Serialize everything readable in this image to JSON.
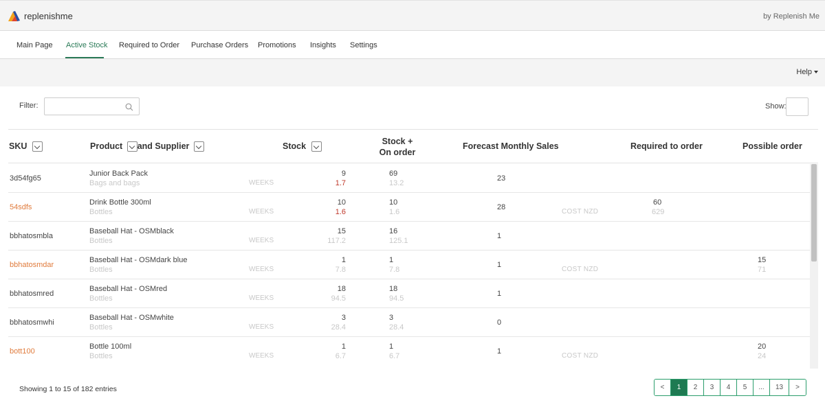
{
  "app": {
    "name": "replenishme",
    "byline": "by Replenish Me"
  },
  "nav": {
    "items": [
      {
        "label": "Main Page"
      },
      {
        "label": "Active Stock"
      },
      {
        "label": "Required to Order"
      },
      {
        "label": "Purchase Orders"
      },
      {
        "label": "Promotions"
      },
      {
        "label": "Insights"
      },
      {
        "label": "Settings"
      }
    ],
    "active": "Active Stock"
  },
  "help": {
    "label": "Help"
  },
  "filter": {
    "label": "Filter:",
    "value": ""
  },
  "show": {
    "label": "Show:",
    "value": ""
  },
  "table": {
    "headers": {
      "sku": "SKU",
      "product": "Product",
      "supplier": "and Supplier",
      "stock": "Stock",
      "stock_on_order_1": "Stock +",
      "stock_on_order_2": "On order",
      "forecast": "Forecast Monthly Sales",
      "required": "Required to order",
      "possible": "Possible order"
    },
    "rows": [
      {
        "sku": "3d54fg65",
        "sku_link": false,
        "product": "Junior Back Pack",
        "supplier": "Bags and bags",
        "weeks_label": "WEEKS",
        "stock": "9",
        "stock_weeks": "1.7",
        "stock_low": true,
        "stock_on_order": "69",
        "stock_on_order_weeks": "13.2",
        "forecast": "23",
        "cost_label": "",
        "required": "",
        "required_sub": "",
        "possible": "",
        "possible_sub": ""
      },
      {
        "sku": "54sdfs",
        "sku_link": true,
        "product": "Drink Bottle 300ml",
        "supplier": "Bottles",
        "weeks_label": "WEEKS",
        "stock": "10",
        "stock_weeks": "1.6",
        "stock_low": true,
        "stock_on_order": "10",
        "stock_on_order_weeks": "1.6",
        "forecast": "28",
        "cost_label": "COST  NZD",
        "required": "60",
        "required_sub": "629",
        "possible": "",
        "possible_sub": ""
      },
      {
        "sku": "bbhatosmbla",
        "sku_link": false,
        "product": "Baseball Hat - OSMblack",
        "supplier": "Bottles",
        "weeks_label": "WEEKS",
        "stock": "15",
        "stock_weeks": "117.2",
        "stock_low": false,
        "stock_on_order": "16",
        "stock_on_order_weeks": "125.1",
        "forecast": "1",
        "cost_label": "",
        "required": "",
        "required_sub": "",
        "possible": "",
        "possible_sub": ""
      },
      {
        "sku": "bbhatosmdar",
        "sku_link": true,
        "product": "Baseball Hat - OSMdark blue",
        "supplier": "Bottles",
        "weeks_label": "WEEKS",
        "stock": "1",
        "stock_weeks": "7.8",
        "stock_low": false,
        "stock_on_order": "1",
        "stock_on_order_weeks": "7.8",
        "forecast": "1",
        "cost_label": "COST  NZD",
        "required": "",
        "required_sub": "",
        "possible": "15",
        "possible_sub": "71"
      },
      {
        "sku": "bbhatosmred",
        "sku_link": false,
        "product": "Baseball Hat - OSMred",
        "supplier": "Bottles",
        "weeks_label": "WEEKS",
        "stock": "18",
        "stock_weeks": "94.5",
        "stock_low": false,
        "stock_on_order": "18",
        "stock_on_order_weeks": "94.5",
        "forecast": "1",
        "cost_label": "",
        "required": "",
        "required_sub": "",
        "possible": "",
        "possible_sub": ""
      },
      {
        "sku": "bbhatosmwhi",
        "sku_link": false,
        "product": "Baseball Hat - OSMwhite",
        "supplier": "Bottles",
        "weeks_label": "WEEKS",
        "stock": "3",
        "stock_weeks": "28.4",
        "stock_low": false,
        "stock_on_order": "3",
        "stock_on_order_weeks": "28.4",
        "forecast": "0",
        "cost_label": "",
        "required": "",
        "required_sub": "",
        "possible": "",
        "possible_sub": ""
      },
      {
        "sku": "bott100",
        "sku_link": true,
        "product": "Bottle 100ml",
        "supplier": "Bottles",
        "weeks_label": "WEEKS",
        "stock": "1",
        "stock_weeks": "6.7",
        "stock_low": false,
        "stock_on_order": "1",
        "stock_on_order_weeks": "6.7",
        "forecast": "1",
        "cost_label": "COST  NZD",
        "required": "",
        "required_sub": "",
        "possible": "20",
        "possible_sub": "24"
      }
    ]
  },
  "footer": {
    "info": "Showing 1 to 15 of 182 entries"
  },
  "pagination": {
    "prev": "<",
    "pages": [
      "1",
      "2",
      "3",
      "4",
      "5",
      "...",
      "13"
    ],
    "current": "1",
    "next": ">"
  },
  "colors": {
    "accent": "#1e7a52",
    "link": "#e07b3c",
    "low_stock": "#c0392b",
    "muted": "#c8c8c8"
  }
}
